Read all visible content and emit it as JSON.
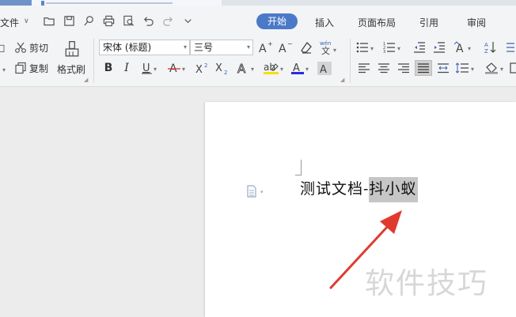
{
  "menubar": {
    "file_label": "文件",
    "tabs": [
      {
        "label": "开始"
      },
      {
        "label": "插入"
      },
      {
        "label": "页面布局"
      },
      {
        "label": "引用"
      },
      {
        "label": "审阅"
      }
    ]
  },
  "clipboard": {
    "cut_label": "剪切",
    "copy_label": "复制",
    "format_painter_label": "格式刷"
  },
  "font": {
    "family": "宋体 (标题)",
    "size": "三号",
    "pinyin_glyph": "wén"
  },
  "document": {
    "text_plain": "测试文档-",
    "text_selected": "抖小蚁"
  },
  "watermark": "软件技巧",
  "colors": {
    "accent": "#4a79c8",
    "arrow": "#e03a2f",
    "selection": "#c6c6c6"
  }
}
